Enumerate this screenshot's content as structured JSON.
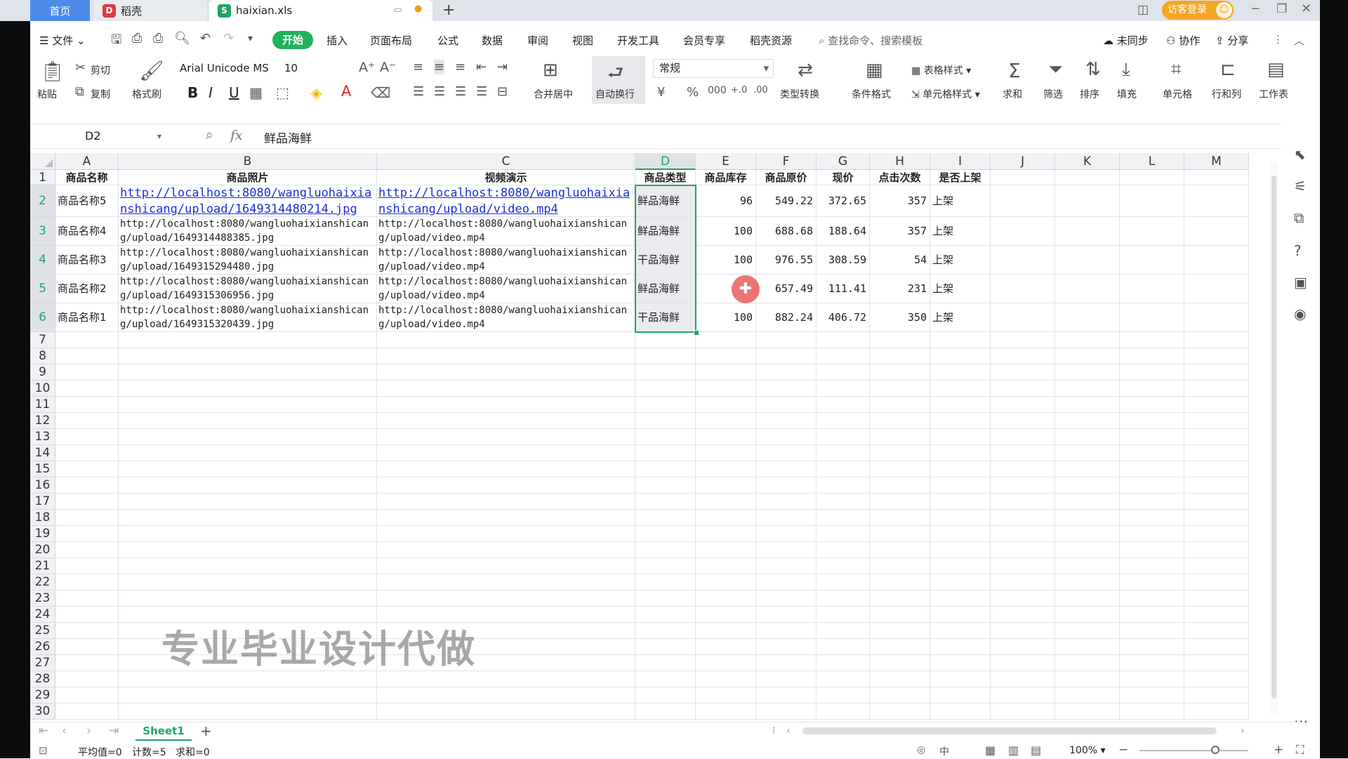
{
  "titlebar": {
    "home_tab": "首页",
    "docer_tab": "稻壳",
    "file_tab": "haixian.xls",
    "new_tab": "+",
    "login_button": "访客登录"
  },
  "menubar": {
    "file": "文件",
    "items": [
      "开始",
      "插入",
      "页面布局",
      "公式",
      "数据",
      "审阅",
      "视图",
      "开发工具",
      "会员专享",
      "稻壳资源"
    ],
    "search_placeholder": "查找命令、搜索模板",
    "sync": "未同步",
    "collab": "协作",
    "share": "分享"
  },
  "ribbon": {
    "paste": "粘贴",
    "cut": "剪切",
    "copy": "复制",
    "format_painter": "格式刷",
    "font_name": "Arial Unicode MS",
    "font_size": "10",
    "merge_center": "合并居中",
    "wrap_text": "自动换行",
    "number_format": "常规",
    "type_convert": "类型转换",
    "conditional_format": "条件格式",
    "table_style": "表格样式",
    "cell_style": "单元格样式",
    "sum": "求和",
    "filter": "筛选",
    "sort": "排序",
    "fill": "填充",
    "cell": "单元格",
    "row_col": "行和列",
    "worksheet": "工作表"
  },
  "formula_bar": {
    "name_box": "D2",
    "fx": "fx",
    "value": "鲜品海鲜"
  },
  "grid": {
    "columns": [
      "A",
      "B",
      "C",
      "D",
      "E",
      "F",
      "G",
      "H",
      "I",
      "J",
      "K",
      "L",
      "M"
    ],
    "rows": [
      "1",
      "2",
      "3",
      "4",
      "5",
      "6",
      "7",
      "8",
      "9",
      "10",
      "11",
      "12",
      "13",
      "14",
      "15",
      "16",
      "17",
      "18",
      "19",
      "20",
      "21",
      "22",
      "23",
      "24",
      "25",
      "26",
      "27",
      "28",
      "29",
      "30"
    ],
    "headers": [
      "商品名称",
      "商品照片",
      "视频演示",
      "商品类型",
      "商品库存",
      "商品原价",
      "现价",
      "点击次数",
      "是否上架"
    ],
    "data": [
      [
        "商品名称5",
        "http://localhost:8080/wangluohaixianshicang/upload/1649314480214.jpg",
        "http://localhost:8080/wangluohaixianshicang/upload/video.mp4",
        "鲜品海鲜",
        "96",
        "549.22",
        "372.65",
        "357",
        "上架"
      ],
      [
        "商品名称4",
        "http://localhost:8080/wangluohaixianshicang/upload/1649314488385.jpg",
        "http://localhost:8080/wangluohaixianshicang/upload/video.mp4",
        "鲜品海鲜",
        "100",
        "688.68",
        "188.64",
        "357",
        "上架"
      ],
      [
        "商品名称3",
        "http://localhost:8080/wangluohaixianshicang/upload/1649315294480.jpg",
        "http://localhost:8080/wangluohaixianshicang/upload/video.mp4",
        "干品海鲜",
        "100",
        "976.55",
        "308.59",
        "54",
        "上架"
      ],
      [
        "商品名称2",
        "http://localhost:8080/wangluohaixianshicang/upload/1649315306956.jpg",
        "http://localhost:8080/wangluohaixianshicang/upload/video.mp4",
        "鲜品海鲜",
        "",
        "657.49",
        "111.41",
        "231",
        "上架"
      ],
      [
        "商品名称1",
        "http://localhost:8080/wangluohaixianshicang/upload/1649315320439.jpg",
        "http://localhost:8080/wangluohaixianshicang/upload/video.mp4",
        "干品海鲜",
        "100",
        "882.24",
        "406.72",
        "350",
        "上架"
      ]
    ]
  },
  "sheets": {
    "active": "Sheet1",
    "add": "+"
  },
  "statusbar": {
    "average": "平均值=0",
    "count": "计数=5",
    "sum": "求和=0",
    "zoom": "100%",
    "ime": "中"
  },
  "watermark": "专业毕业设计代做",
  "colors": {
    "accent_green": "#1fb35b",
    "home_tab_blue": "#4c8ce8",
    "login_orange": "#f5a623",
    "link_blue": "#1a2fd6",
    "selection_green": "#1fa463"
  }
}
